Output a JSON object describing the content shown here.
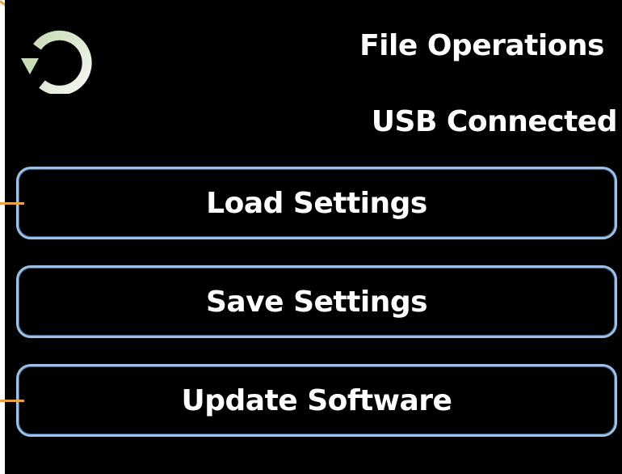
{
  "colors": {
    "background": "#000000",
    "text": "#ffffff",
    "button_border": "#9ec0e6",
    "callout_line": "#e8a33c",
    "back_icon_start": "#c9dcb8",
    "back_icon_end": "#f4f7f1"
  },
  "header": {
    "back_icon": "refresh-back-icon",
    "title": "File Operations",
    "status": "USB Connected"
  },
  "actions": [
    {
      "label": "Load Settings"
    },
    {
      "label": "Save Settings"
    },
    {
      "label": "Update Software"
    }
  ]
}
